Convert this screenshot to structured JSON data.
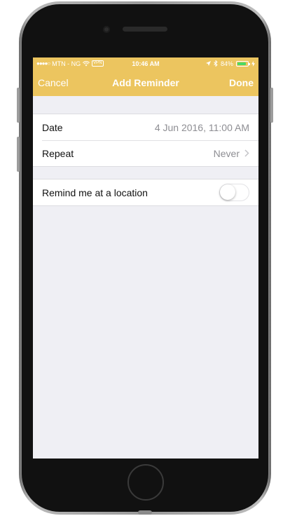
{
  "status_bar": {
    "signal_dots": "●●●●○",
    "carrier": "MTN - NG",
    "vpn": "VPN",
    "time": "10:46 AM",
    "battery_percent": "84%",
    "battery_level": 0.84,
    "battery_color": "#4cd964"
  },
  "nav_bar": {
    "cancel_label": "Cancel",
    "title": "Add Reminder",
    "done_label": "Done",
    "color": "#ecc55f"
  },
  "schedule": {
    "date_label": "Date",
    "date_value": "4 Jun 2016, 11:00 AM",
    "repeat_label": "Repeat",
    "repeat_value": "Never"
  },
  "location": {
    "label": "Remind me at a location",
    "enabled": false
  }
}
